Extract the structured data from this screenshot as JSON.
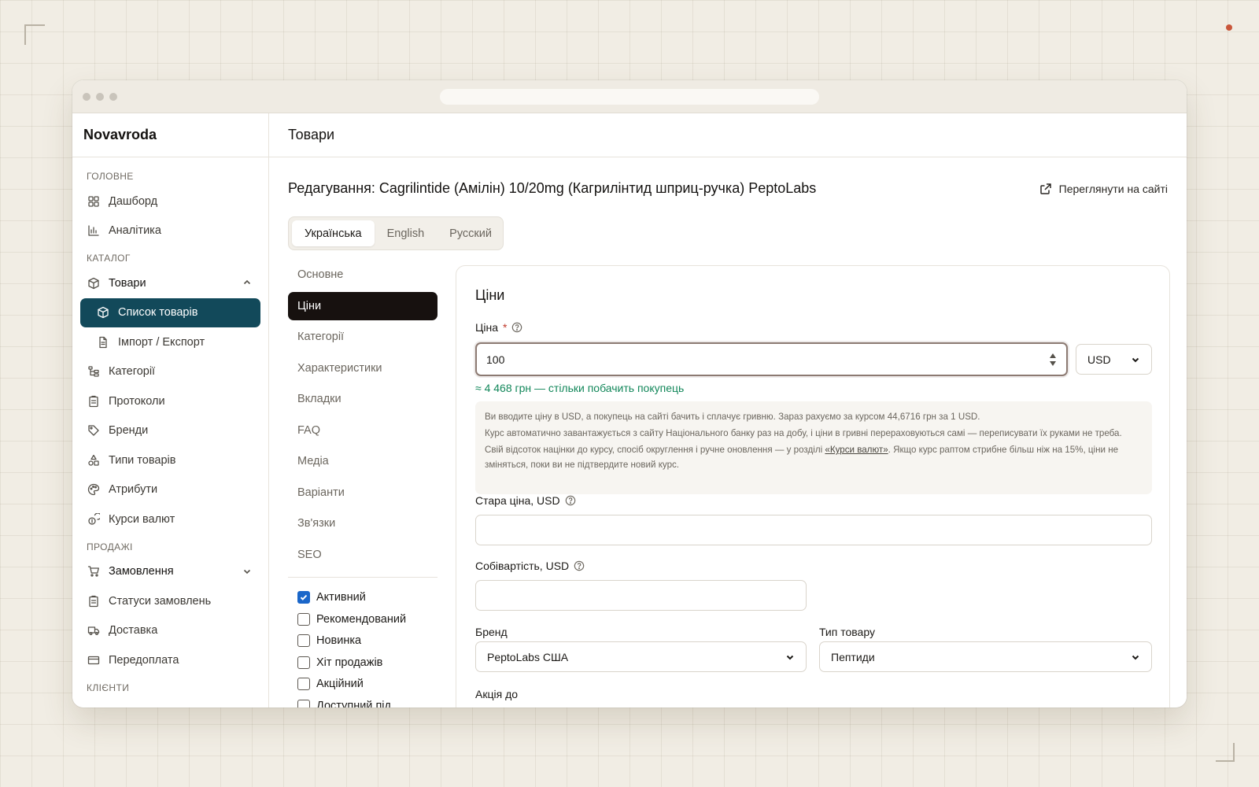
{
  "app": {
    "brand": "Novavroda",
    "header_title": "Товари"
  },
  "sidebar": {
    "sections": [
      {
        "label": "ГОЛОВНЕ",
        "items": [
          {
            "label": "Дашборд",
            "icon": "dashboard-icon"
          },
          {
            "label": "Аналітика",
            "icon": "analytics-icon"
          }
        ]
      },
      {
        "label": "КАТАЛОГ",
        "items": [
          {
            "label": "Товари",
            "icon": "box-icon",
            "expanded": true
          },
          {
            "label": "Список товарів",
            "icon": "box-icon",
            "active": true,
            "sub": true
          },
          {
            "label": "Імпорт / Експорт",
            "icon": "file-icon",
            "sub": true
          },
          {
            "label": "Категорії",
            "icon": "tree-icon"
          },
          {
            "label": "Протоколи",
            "icon": "clipboard-icon"
          },
          {
            "label": "Бренди",
            "icon": "tag-icon"
          },
          {
            "label": "Типи товарів",
            "icon": "shapes-icon"
          },
          {
            "label": "Атрибути",
            "icon": "palette-icon"
          },
          {
            "label": "Курси валют",
            "icon": "coins-icon"
          }
        ]
      },
      {
        "label": "ПРОДАЖІ",
        "items": [
          {
            "label": "Замовлення",
            "icon": "cart-icon",
            "expanded": false
          },
          {
            "label": "Статуси замовлень",
            "icon": "clipboard-icon"
          },
          {
            "label": "Доставка",
            "icon": "truck-icon"
          },
          {
            "label": "Передоплата",
            "icon": "card-icon"
          }
        ]
      },
      {
        "label": "КЛІЄНТИ",
        "items": []
      }
    ]
  },
  "page": {
    "title": "Редагування: Cagrilintide (Амілін) 10/20mg (Кагрилінтид шприц-ручка) PeptoLabs",
    "view_link": "Переглянути на сайті"
  },
  "lang_tabs": [
    {
      "label": "Українська",
      "active": true
    },
    {
      "label": "English",
      "active": false
    },
    {
      "label": "Русский",
      "active": false
    }
  ],
  "section_nav": [
    {
      "label": "Основне"
    },
    {
      "label": "Ціни",
      "active": true
    },
    {
      "label": "Категорії"
    },
    {
      "label": "Характеристики"
    },
    {
      "label": "Вкладки"
    },
    {
      "label": "FAQ"
    },
    {
      "label": "Медіа"
    },
    {
      "label": "Варіанти"
    },
    {
      "label": "Зв'язки"
    },
    {
      "label": "SEO"
    }
  ],
  "flags": [
    {
      "label": "Активний",
      "checked": true
    },
    {
      "label": "Рекомендований",
      "checked": false
    },
    {
      "label": "Новинка",
      "checked": false
    },
    {
      "label": "Хіт продажів",
      "checked": false
    },
    {
      "label": "Акційний",
      "checked": false
    },
    {
      "label": "Доступний під",
      "checked": false
    }
  ],
  "prices": {
    "card_title": "Ціни",
    "price_label": "Ціна",
    "required_mark": "*",
    "price_value": "100",
    "currency": "USD",
    "uah_hint": "≈ 4 468 грн — стільки побачить покупець",
    "info_line1": "Ви вводите ціну в USD, а покупець на сайті бачить і сплачує гривню. Зараз рахуємо за курсом 44,6716 грн за 1 USD.",
    "info_line2": "Курс автоматично завантажується з сайту Національного банку раз на добу, і ціни в гривні перераховуються самі — переписувати їх руками не треба.",
    "info_line3_before": "Свій відсоток націнки до курсу, спосіб округлення і ручне оновлення — у розділі ",
    "info_line3_link": "«Курси валют»",
    "info_line3_after": ". Якщо курс раптом стрибне більш ніж на 15%, ціни не зміняться, поки ви не підтвердите новий курс.",
    "old_price_label": "Стара ціна, USD",
    "old_price_value": "",
    "cost_label": "Собівартість, USD",
    "cost_value": "",
    "brand_label": "Бренд",
    "brand_value": "PeptoLabs США",
    "type_label": "Тип товару",
    "type_value": "Пептиди",
    "promo_label": "Акція до"
  },
  "colors": {
    "accent": "#12495a",
    "active_section": "#17110f",
    "success": "#12875a",
    "checkbox": "#1a66c9"
  }
}
